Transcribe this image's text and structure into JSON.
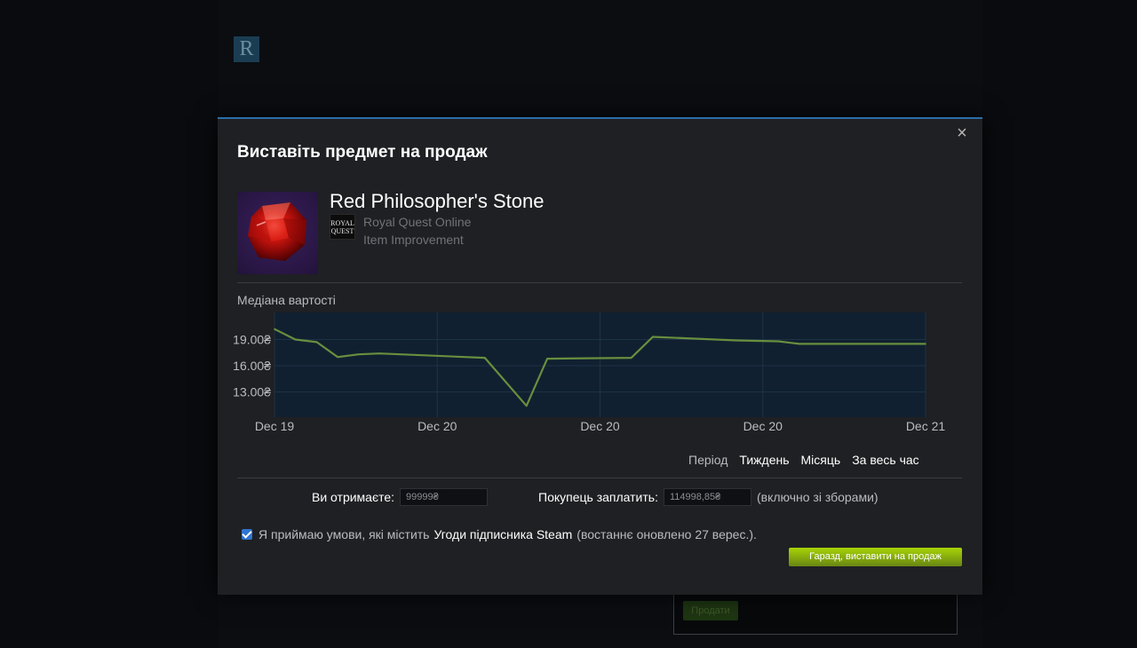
{
  "background": {
    "logo_letter": "R",
    "button_label": "Продати"
  },
  "modal": {
    "title": "Виставіть предмет на продаж",
    "close_glyph": "×",
    "accent_color": "#2b6fa8"
  },
  "item": {
    "name": "Red Philosopher's Stone",
    "game_icon_text": "ROYAL QUEST",
    "game": "Royal Quest Online",
    "type": "Item Improvement",
    "image": "red-gem-icon"
  },
  "chart_label": "Медіана вартості",
  "chart_data": {
    "type": "line",
    "title": "Медіана вартості",
    "x_ticks": [
      "Dec 19",
      "Dec 20",
      "Dec 20",
      "Dec 20",
      "Dec 21"
    ],
    "y_ticks": [
      "19.00₴",
      "16.00₴",
      "13.00₴"
    ],
    "y_tick_values": [
      19,
      16,
      13
    ],
    "ylim": [
      10.1,
      22.1
    ],
    "x_range": [
      0,
      100
    ],
    "series": [
      {
        "color": "#688f3e",
        "points": [
          [
            0,
            20.2
          ],
          [
            3.2,
            19.0
          ],
          [
            6.5,
            18.7
          ],
          [
            9.7,
            17.0
          ],
          [
            12.9,
            17.3
          ],
          [
            16.1,
            17.4
          ],
          [
            32.3,
            16.9
          ],
          [
            38.7,
            11.4
          ],
          [
            41.9,
            16.8
          ],
          [
            54.8,
            16.9
          ],
          [
            58.1,
            19.3
          ],
          [
            71.0,
            18.9
          ],
          [
            77.4,
            18.8
          ],
          [
            80.6,
            18.5
          ],
          [
            100,
            18.5
          ]
        ]
      }
    ],
    "grid": true,
    "plot_bg": "#112030",
    "grid_color": "#1d3246"
  },
  "period": {
    "label": "Період",
    "options": [
      "Тиждень",
      "Місяць",
      "За весь час"
    ]
  },
  "pricing": {
    "receive_label": "Ви отримаєте:",
    "receive_value": "99999₴",
    "buyer_label": "Покупець заплатить:",
    "buyer_value": "114998,85₴",
    "fees_note": "(включно зі зборами)"
  },
  "terms": {
    "checked": true,
    "prefix": "Я приймаю умови, які містить",
    "link": "Угоди підписника Steam",
    "suffix": "(востаннє оновлено 27 верес.)."
  },
  "submit_label": "Гаразд, виставити на продаж"
}
